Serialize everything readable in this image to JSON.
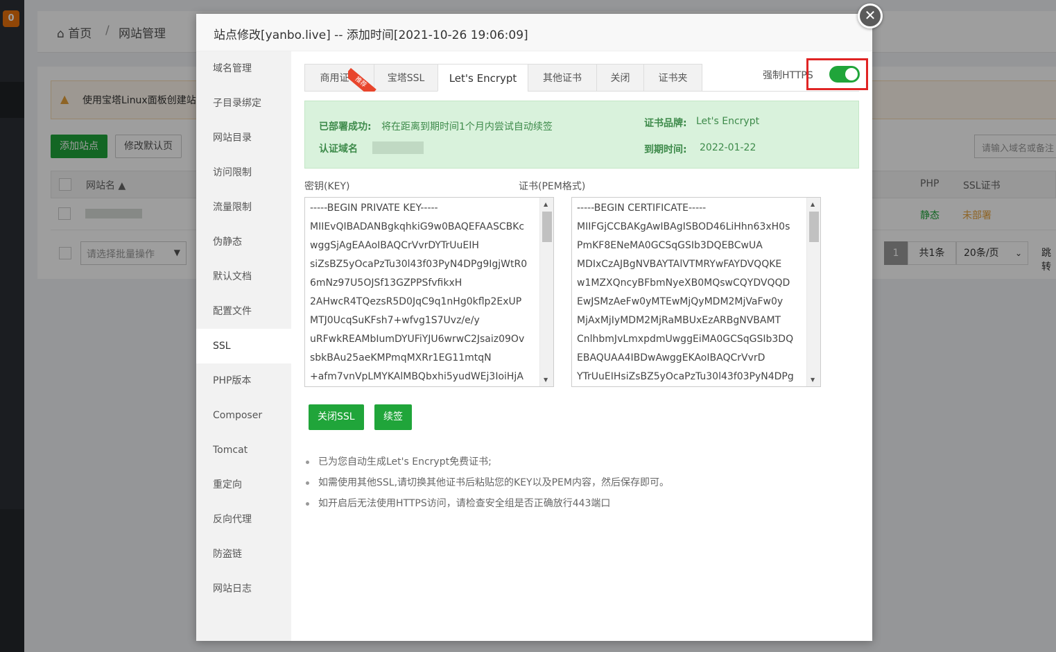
{
  "background": {
    "notification_count": "0",
    "breadcrumb": {
      "home": "首页",
      "separator": "/",
      "current": "网站管理"
    },
    "alert_text": "使用宝塔Linux面板创建站",
    "buttons": {
      "add_site": "添加站点",
      "modify_default": "修改默认页"
    },
    "search_placeholder": "请输入域名或备注",
    "table": {
      "headers": {
        "name": "网站名",
        "php": "PHP",
        "ssl": "SSL证书"
      },
      "row": {
        "php": "静态",
        "ssl": "未部署"
      }
    },
    "batch_select": "请选择批量操作",
    "pagination": {
      "page": "1",
      "total": "共1条",
      "per_page": "20条/页",
      "jump": "跳转"
    }
  },
  "modal": {
    "title": "站点修改[yanbo.live] -- 添加时间[2021-10-26 19:06:09]",
    "sidebar": [
      {
        "label": "域名管理"
      },
      {
        "label": "子目录绑定"
      },
      {
        "label": "网站目录"
      },
      {
        "label": "访问限制"
      },
      {
        "label": "流量限制"
      },
      {
        "label": "伪静态"
      },
      {
        "label": "默认文档"
      },
      {
        "label": "配置文件"
      },
      {
        "label": "SSL",
        "active": true
      },
      {
        "label": "PHP版本"
      },
      {
        "label": "Composer"
      },
      {
        "label": "Tomcat"
      },
      {
        "label": "重定向"
      },
      {
        "label": "反向代理"
      },
      {
        "label": "防盗链"
      },
      {
        "label": "网站日志"
      }
    ],
    "tabs": [
      {
        "label": "商用证书"
      },
      {
        "label": "宝塔SSL"
      },
      {
        "label": "Let's Encrypt",
        "active": true
      },
      {
        "label": "其他证书"
      },
      {
        "label": "关闭"
      },
      {
        "label": "证书夹"
      }
    ],
    "hot_badge": "推荐",
    "force_https": {
      "label": "强制HTTPS",
      "enabled": true
    },
    "status": {
      "deployed_label": "已部署成功:",
      "deployed_text": "将在距离到期时间1个月内尝试自动续签",
      "domain_label": "认证域名",
      "brand_label": "证书品牌:",
      "brand_value": "Let's Encrypt",
      "expiry_label": "到期时间:",
      "expiry_value": "2022-01-22"
    },
    "key_label": "密钥(KEY)",
    "cert_label": "证书(PEM格式)",
    "key_lines": [
      "-----BEGIN PRIVATE KEY-----",
      "MIIEvQIBADANBgkqhkiG9w0BAQEFAASCBKc",
      "wggSjAgEAAoIBAQCrVvrDYTrUuEIH",
      "siZsBZ5yOcaPzTu30l43f03PyN4DPg9IgjWtR0",
      "6mNz97U5OJSf13GZPPSfvfikxH",
      "2AHwcR4TQezsR5D0JqC9q1nHg0kflp2ExUP",
      "MTJ0UcqSuKFsh7+wfvg1S7Uvz/e/y",
      "uRFwkREAMbIumDYUFiYJU6wrwC2Jsaiz09Ov",
      "sbkBAu25aeKMPmqMXRr1EG11mtqN",
      "+afm7vnVpLMYKAlMBQbxhi5yudWEj3IoiHjA"
    ],
    "cert_lines": [
      "-----BEGIN CERTIFICATE-----",
      "MIIFGjCCBAKgAwIBAgISBOD46LiHhn63xH0s",
      "PmKF8ENeMA0GCSqGSIb3DQEBCwUA",
      "MDIxCzAJBgNVBAYTAlVTMRYwFAYDVQQKE",
      "w1MZXQncyBFbmNyeXB0MQswCQYDVQQD",
      "EwJSMzAeFw0yMTEwMjQyMDM2MjVaFw0y",
      "MjAxMjIyMDM2MjRaMBUxEzARBgNVBAMT",
      "CnlhbmJvLmxpdmUwggEiMA0GCSqGSIb3DQ",
      "EBAQUAA4IBDwAwggEKAoIBAQCrVvrD",
      "YTrUuEIHsiZsBZ5yOcaPzTu30l43f03PyN4DPg"
    ],
    "actions": {
      "close_ssl": "关闭SSL",
      "renew": "续签"
    },
    "tips": [
      "已为您自动生成Let's Encrypt免费证书;",
      "如需使用其他SSL,请切换其他证书后粘贴您的KEY以及PEM内容，然后保存即可。",
      "如开启后无法使用HTTPS访问，请检查安全组是否正确放行443端口"
    ]
  },
  "colors": {
    "accent_green": "#20a53a",
    "highlight_red": "#e02424",
    "status_bg": "#d9f2dc"
  }
}
